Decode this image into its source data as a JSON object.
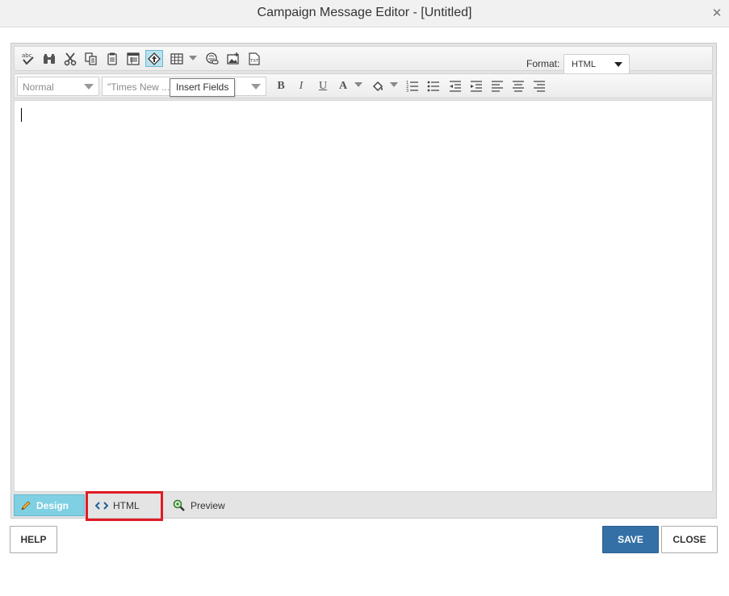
{
  "window": {
    "title": "Campaign Message Editor - [Untitled]",
    "close_icon": "close-icon"
  },
  "toolbar1": {
    "buttons": [
      "spellcheck-icon",
      "find-icon",
      "cut-icon",
      "copy-icon",
      "paste-icon",
      "template-icon",
      "insert-fields-icon",
      "table-icon",
      "link-icon",
      "image-icon",
      "text-file-icon"
    ],
    "format_label": "Format:",
    "format_value": "HTML"
  },
  "toolbar2": {
    "paragraph_style": "Normal",
    "font_name": "\"Times New ...",
    "bold": "B",
    "italic": "I",
    "underline": "U",
    "font_color": "A"
  },
  "tooltip": {
    "text": "Insert Fields"
  },
  "tabs": {
    "design": "Design",
    "html": "HTML",
    "preview": "Preview"
  },
  "footer": {
    "help": "HELP",
    "save": "SAVE",
    "close": "CLOSE"
  },
  "colors": {
    "active_tab": "#7fd0e3",
    "save_button": "#3470a6",
    "highlight": "#e01b24"
  }
}
